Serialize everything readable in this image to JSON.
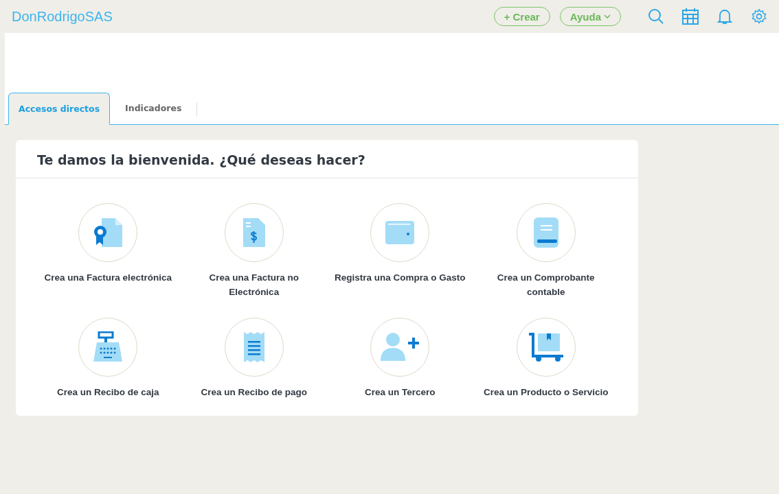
{
  "header": {
    "brand": "DonRodrigoSAS",
    "create_button": {
      "icon": "+",
      "label": "Crear"
    },
    "help_button": {
      "label": "Ayuda"
    }
  },
  "tabs": [
    {
      "label": "Accesos directos",
      "selected": true
    },
    {
      "label": "Indicadores",
      "selected": false
    }
  ],
  "welcome": {
    "title": "Te damos la bienvenida. ¿Qué deseas hacer?",
    "actions": [
      {
        "kind": "invoice",
        "label": "Crea una Factura electrónica"
      },
      {
        "kind": "bill",
        "label": "Crea una Factura no Electrónica"
      },
      {
        "kind": "wallet",
        "label": "Registra una Compra o Gasto"
      },
      {
        "kind": "book",
        "label": "Crea un Comprobante contable"
      },
      {
        "kind": "register",
        "label": "Crea un Recibo de caja"
      },
      {
        "kind": "receipt",
        "label": "Crea un Recibo de pago"
      },
      {
        "kind": "person",
        "label": "Crea un Tercero"
      },
      {
        "kind": "cart",
        "label": "Crea un Producto o Servicio"
      }
    ]
  }
}
